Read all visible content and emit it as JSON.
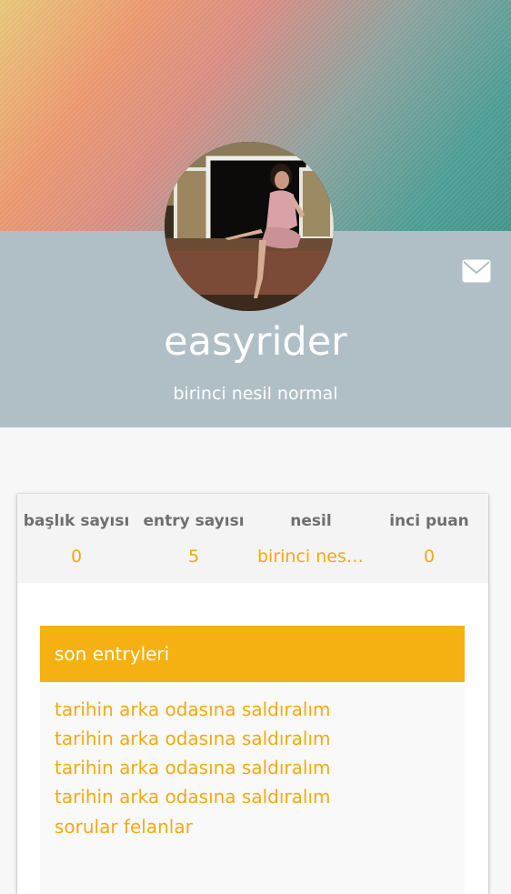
{
  "profile": {
    "username": "easyrider",
    "generation": "birinci nesil normal",
    "avatar_icon": "person-photo-icon",
    "message_icon": "envelope-icon"
  },
  "stats": [
    {
      "label": "başlık sayısı",
      "value": "0"
    },
    {
      "label": "entry sayısı",
      "value": "5"
    },
    {
      "label": "nesil",
      "value": "birinci nesil normal"
    },
    {
      "label": "inci puan",
      "value": "0"
    }
  ],
  "recent_entries": {
    "title": "son entryleri",
    "items": [
      "tarihin arka odasına saldıralım",
      "tarihin arka odasına saldıralım",
      "tarihin arka odasına saldıralım",
      "tarihin arka odasına saldıralım",
      "sorular felanlar"
    ]
  },
  "colors": {
    "accent": "#f5b012",
    "panel": "#b0bfc6",
    "stat_label": "#6f6f6f"
  }
}
